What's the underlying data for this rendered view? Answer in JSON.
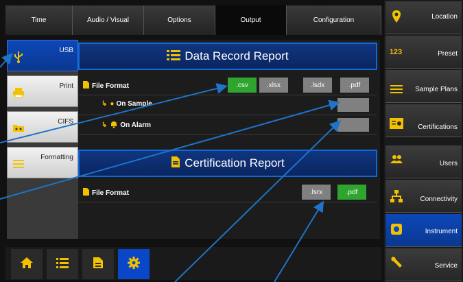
{
  "tabs": [
    "Time",
    "Audio / Visual",
    "Options",
    "Output",
    "Configuration"
  ],
  "active_tab": "Output",
  "side_menu": [
    {
      "label": "USB",
      "icon": "usb-icon",
      "active": true
    },
    {
      "label": "Print",
      "icon": "printer-icon",
      "active": false
    },
    {
      "label": "CIFS",
      "icon": "folder-network-icon",
      "active": false
    },
    {
      "label": "Formatting",
      "icon": "list-icon",
      "active": false
    }
  ],
  "data_record": {
    "title": "Data Record Report",
    "file_format_label": "File Format",
    "formats": [
      ".csv",
      ".xlsx",
      ".lsdx",
      ".pdf"
    ],
    "selected_format": ".csv",
    "on_sample_label": "On Sample",
    "on_alarm_label": "On Alarm"
  },
  "certification": {
    "title": "Certification Report",
    "file_format_label": "File Format",
    "formats": [
      ".lsrx",
      ".pdf"
    ],
    "selected_format": ".pdf"
  },
  "bottom_nav": [
    "home-icon",
    "list-icon",
    "document-icon",
    "gear-icon"
  ],
  "right_menu": [
    {
      "label": "Location",
      "icon": "location-pin-icon",
      "active": false
    },
    {
      "label": "Preset",
      "icon": "123-icon",
      "active": false
    },
    {
      "label": "Sample Plans",
      "icon": "list-icon",
      "active": false
    },
    {
      "label": "Certifications",
      "icon": "certificate-icon",
      "active": false
    },
    {
      "label": "Users",
      "icon": "users-icon",
      "active": false
    },
    {
      "label": "Connectivity",
      "icon": "network-icon",
      "active": false
    },
    {
      "label": "Instrument",
      "icon": "instrument-icon",
      "active": true
    },
    {
      "label": "Service",
      "icon": "wrench-icon",
      "active": false
    }
  ],
  "colors": {
    "accent_blue": "#0a47c8",
    "selected_green": "#2ea52e",
    "icon_yellow": "#f2c200",
    "callout_arrow": "#1f73c8"
  }
}
